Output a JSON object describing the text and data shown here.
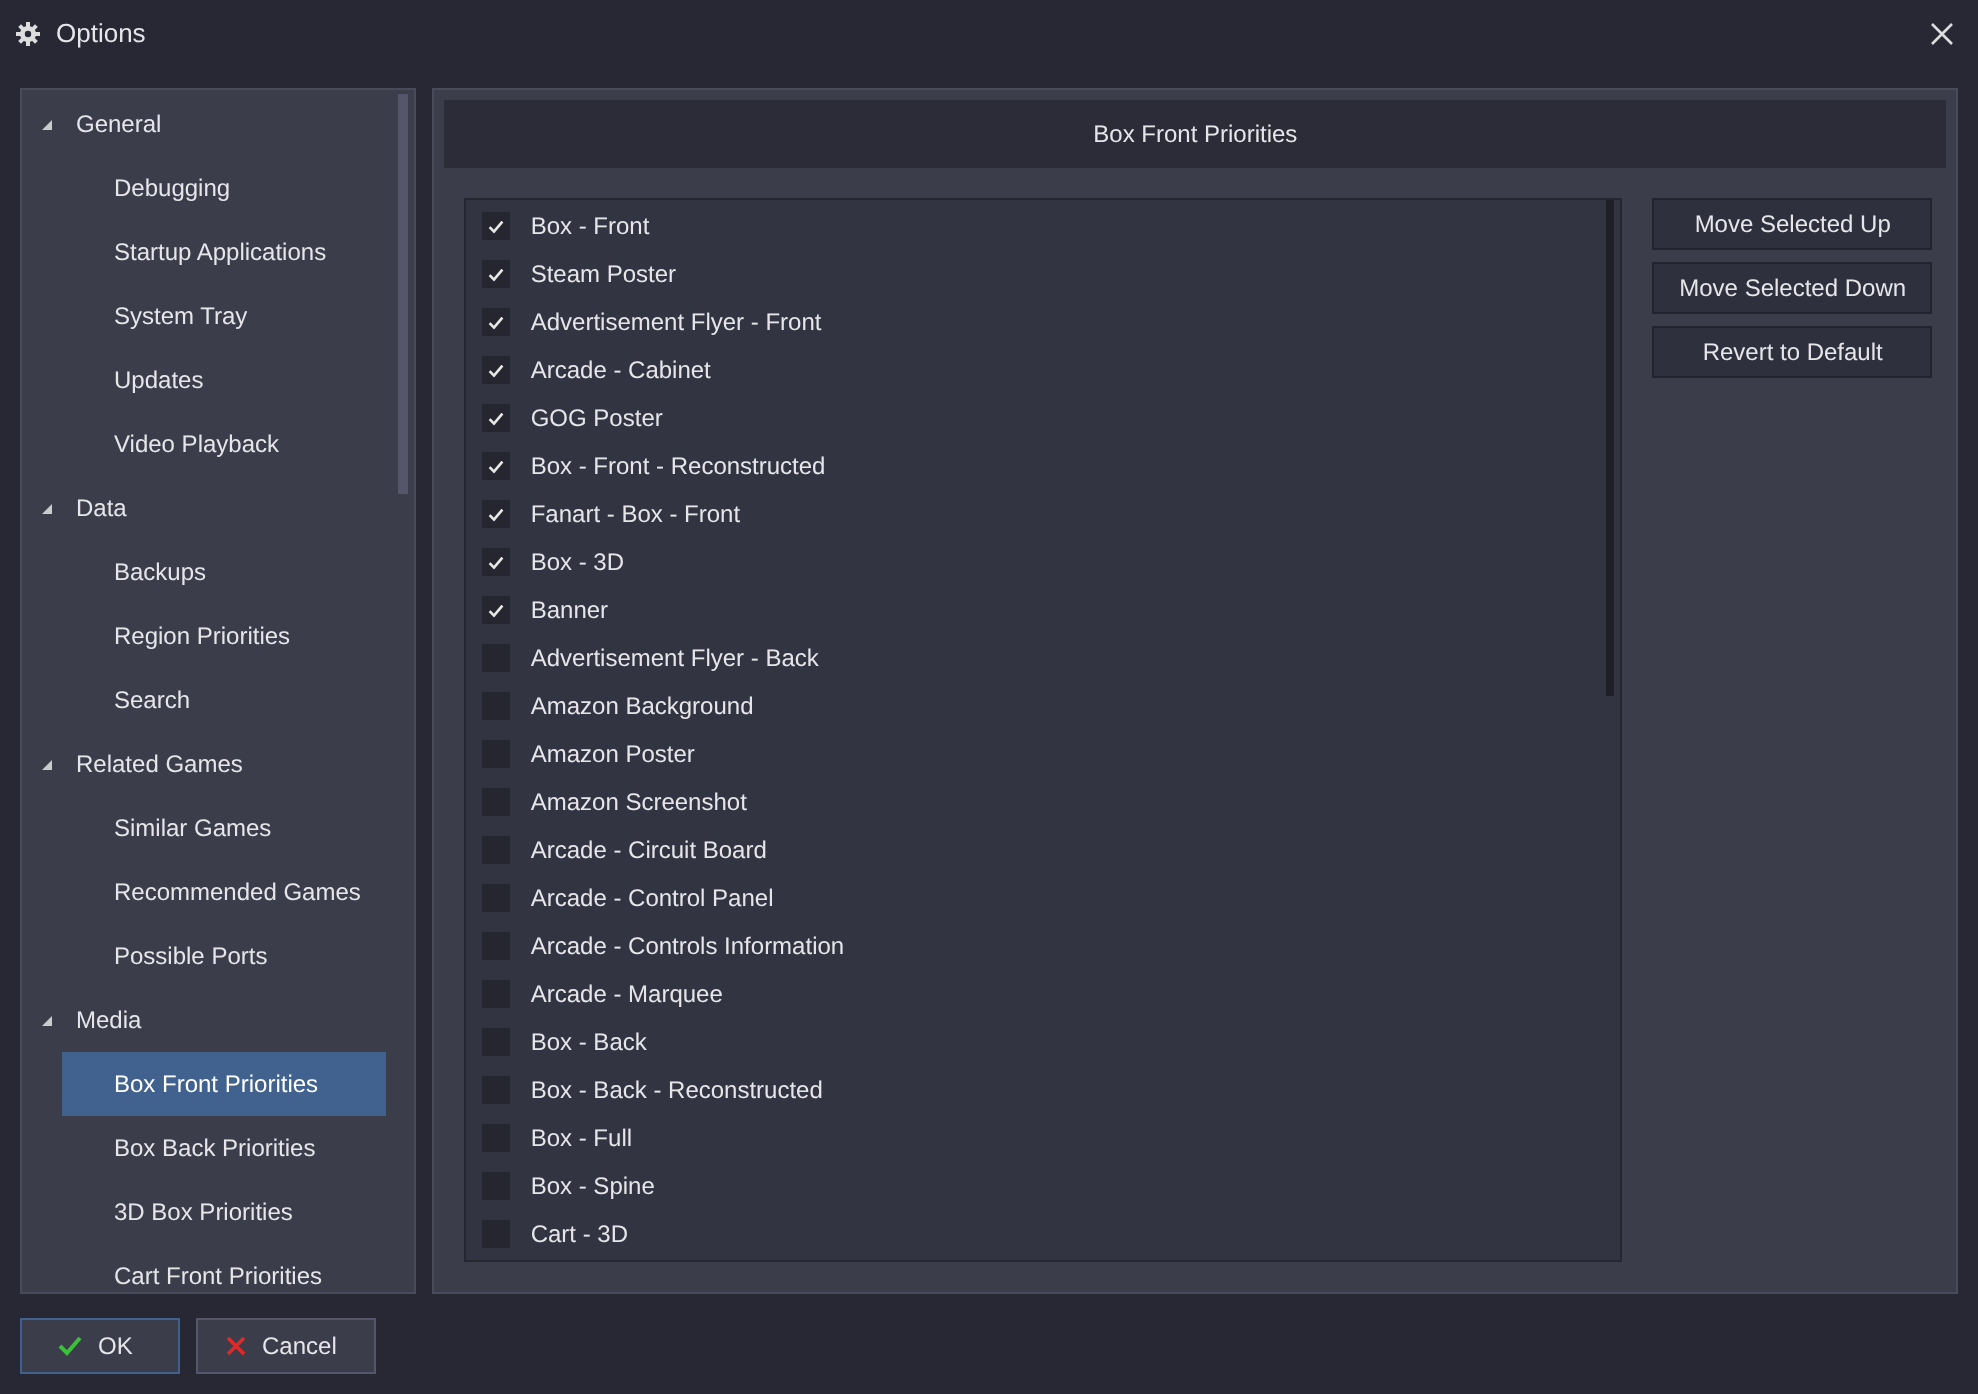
{
  "window": {
    "title": "Options"
  },
  "sidebar": {
    "groups": [
      {
        "label": "General",
        "expanded": true,
        "children": [
          {
            "label": "Debugging",
            "selected": false
          },
          {
            "label": "Startup Applications",
            "selected": false
          },
          {
            "label": "System Tray",
            "selected": false
          },
          {
            "label": "Updates",
            "selected": false
          },
          {
            "label": "Video Playback",
            "selected": false
          }
        ]
      },
      {
        "label": "Data",
        "expanded": true,
        "children": [
          {
            "label": "Backups",
            "selected": false
          },
          {
            "label": "Region Priorities",
            "selected": false
          },
          {
            "label": "Search",
            "selected": false
          }
        ]
      },
      {
        "label": "Related Games",
        "expanded": true,
        "children": [
          {
            "label": "Similar Games",
            "selected": false
          },
          {
            "label": "Recommended Games",
            "selected": false
          },
          {
            "label": "Possible Ports",
            "selected": false
          }
        ]
      },
      {
        "label": "Media",
        "expanded": true,
        "children": [
          {
            "label": "Box Front Priorities",
            "selected": true
          },
          {
            "label": "Box Back Priorities",
            "selected": false
          },
          {
            "label": "3D Box Priorities",
            "selected": false
          },
          {
            "label": "Cart Front Priorities",
            "selected": false
          }
        ]
      }
    ]
  },
  "panel": {
    "title": "Box Front Priorities",
    "items": [
      {
        "label": "Box - Front",
        "checked": true
      },
      {
        "label": "Steam Poster",
        "checked": true
      },
      {
        "label": "Advertisement Flyer - Front",
        "checked": true
      },
      {
        "label": "Arcade - Cabinet",
        "checked": true
      },
      {
        "label": "GOG Poster",
        "checked": true
      },
      {
        "label": "Box - Front - Reconstructed",
        "checked": true
      },
      {
        "label": "Fanart - Box - Front",
        "checked": true
      },
      {
        "label": "Box - 3D",
        "checked": true
      },
      {
        "label": "Banner",
        "checked": true
      },
      {
        "label": "Advertisement Flyer - Back",
        "checked": false
      },
      {
        "label": "Amazon Background",
        "checked": false
      },
      {
        "label": "Amazon Poster",
        "checked": false
      },
      {
        "label": "Amazon Screenshot",
        "checked": false
      },
      {
        "label": "Arcade - Circuit Board",
        "checked": false
      },
      {
        "label": "Arcade - Control Panel",
        "checked": false
      },
      {
        "label": "Arcade - Controls Information",
        "checked": false
      },
      {
        "label": "Arcade - Marquee",
        "checked": false
      },
      {
        "label": "Box - Back",
        "checked": false
      },
      {
        "label": "Box - Back - Reconstructed",
        "checked": false
      },
      {
        "label": "Box - Full",
        "checked": false
      },
      {
        "label": "Box - Spine",
        "checked": false
      },
      {
        "label": "Cart - 3D",
        "checked": false
      }
    ],
    "buttons": [
      "Move Selected Up",
      "Move Selected Down",
      "Revert to Default"
    ]
  },
  "footer": {
    "buttons": [
      {
        "label": "OK",
        "kind": "ok"
      },
      {
        "label": "Cancel",
        "kind": "cancel"
      }
    ]
  }
}
